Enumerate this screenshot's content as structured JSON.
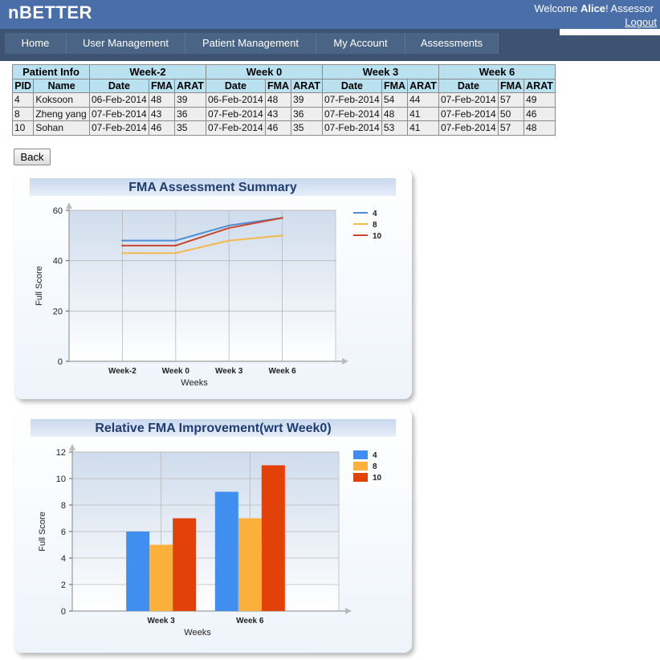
{
  "header": {
    "brand": "nBETTER",
    "welcome_prefix": "Welcome ",
    "user_name": "Alice",
    "welcome_suffix": "! Assessor",
    "logout": "Logout"
  },
  "nav": [
    {
      "label": "Home"
    },
    {
      "label": "User Management"
    },
    {
      "label": "Patient Management"
    },
    {
      "label": "My Account"
    },
    {
      "label": "Assessments"
    }
  ],
  "table": {
    "group_headers": [
      "Patient Info",
      "Week-2",
      "Week 0",
      "Week 3",
      "Week 6"
    ],
    "sub_headers": [
      "PID",
      "Name",
      "Date",
      "FMA",
      "ARAT",
      "Date",
      "FMA",
      "ARAT",
      "Date",
      "FMA",
      "ARAT",
      "Date",
      "FMA",
      "ARAT"
    ],
    "rows": [
      [
        "4",
        "Koksoon",
        "06-Feb-2014",
        "48",
        "39",
        "06-Feb-2014",
        "48",
        "39",
        "07-Feb-2014",
        "54",
        "44",
        "07-Feb-2014",
        "57",
        "49"
      ],
      [
        "8",
        "Zheng yang",
        "07-Feb-2014",
        "43",
        "36",
        "07-Feb-2014",
        "43",
        "36",
        "07-Feb-2014",
        "48",
        "41",
        "07-Feb-2014",
        "50",
        "46"
      ],
      [
        "10",
        "Sohan",
        "07-Feb-2014",
        "46",
        "35",
        "07-Feb-2014",
        "46",
        "35",
        "07-Feb-2014",
        "53",
        "41",
        "07-Feb-2014",
        "57",
        "48"
      ]
    ]
  },
  "back_label": "Back",
  "colors": {
    "series_4_line": "#4a8fd6",
    "series_8_line": "#f5b84a",
    "series_10_line": "#c8472c",
    "series_4_bar": "#3f8ef0",
    "series_8_bar": "#fbb03b",
    "series_10_bar": "#e2420a",
    "title": "#1f3d73"
  },
  "chart_data": [
    {
      "type": "line",
      "title": "FMA Assessment Summary",
      "xlabel": "Weeks",
      "ylabel": "Full Score",
      "categories": [
        "Week-2",
        "Week 0",
        "Week 3",
        "Week 6"
      ],
      "ylim": [
        0,
        60
      ],
      "yticks": [
        0,
        20,
        40,
        60
      ],
      "grid": true,
      "legend": "top-right",
      "series": [
        {
          "name": "4",
          "values": [
            48,
            48,
            54,
            57
          ]
        },
        {
          "name": "8",
          "values": [
            43,
            43,
            48,
            50
          ]
        },
        {
          "name": "10",
          "values": [
            46,
            46,
            53,
            57
          ]
        }
      ]
    },
    {
      "type": "bar",
      "title": "Relative FMA Improvement(wrt Week0)",
      "xlabel": "Weeks",
      "ylabel": "Full Score",
      "categories": [
        "Week 3",
        "Week 6"
      ],
      "ylim": [
        0,
        12
      ],
      "yticks": [
        0,
        2,
        4,
        6,
        8,
        10,
        12
      ],
      "grid": true,
      "legend": "top-right",
      "series": [
        {
          "name": "4",
          "values": [
            6,
            9
          ]
        },
        {
          "name": "8",
          "values": [
            5,
            7
          ]
        },
        {
          "name": "10",
          "values": [
            7,
            11
          ]
        }
      ]
    }
  ]
}
